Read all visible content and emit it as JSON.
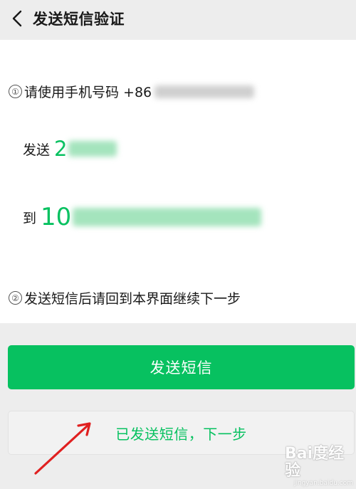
{
  "header": {
    "title": "发送短信验证",
    "back_icon": "chevron-left-icon"
  },
  "steps": {
    "step1_num": "①",
    "step1_text": "请使用手机号码 +86",
    "send_label": "发送",
    "send_code_visible": "2",
    "to_label": "到",
    "to_number_visible": "10",
    "step2_num": "②",
    "step2_text": "发送短信后请回到本界面继续下一步"
  },
  "buttons": {
    "send_sms": "发送短信",
    "sent_next": "已发送短信，下一步"
  },
  "watermark": {
    "text": "Bai度经验",
    "sub": "jingyan.baidu.com"
  },
  "colors": {
    "accent": "#07c160",
    "background": "#ededed",
    "card": "#ffffff",
    "arrow": "#e02020"
  }
}
